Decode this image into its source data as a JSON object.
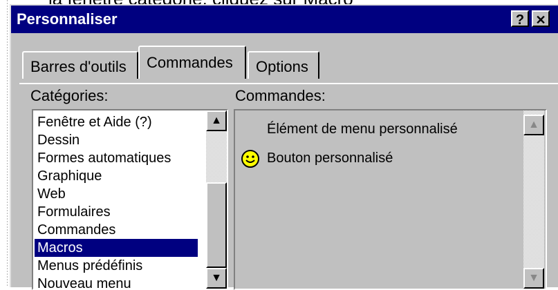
{
  "page_top_text": "la fenêtre catégorie, cliquez sur Macro",
  "window": {
    "title": "Personnaliser",
    "help_button": "?",
    "close_button": "✕"
  },
  "tabs": [
    {
      "label": "Barres d'outils",
      "active": false
    },
    {
      "label": "Commandes",
      "active": true
    },
    {
      "label": "Options",
      "active": false
    }
  ],
  "categories": {
    "label": "Catégories:",
    "items": [
      "Fenêtre et Aide (?)",
      "Dessin",
      "Formes automatiques",
      "Graphique",
      "Web",
      "Formulaires",
      "Commandes",
      "Macros",
      "Menus prédéfinis",
      "Nouveau menu"
    ],
    "selected": "Macros"
  },
  "commands": {
    "label": "Commandes:",
    "items": [
      {
        "label": "Élément de menu personnalisé",
        "icon": "none"
      },
      {
        "label": "Bouton personnalisé",
        "icon": "smiley-face-icon"
      }
    ]
  },
  "colors": {
    "title_bar": "#000080",
    "selection": "#000080",
    "face": "#c0c0c0",
    "smiley": "#ffff00"
  }
}
